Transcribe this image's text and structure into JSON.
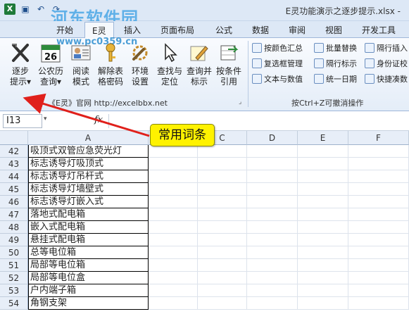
{
  "window": {
    "title": "E灵功能演示之逐步提示.xlsx - ",
    "watermark": "河东软件园",
    "watermark_url": "www.pc0359.cn"
  },
  "tabs": [
    "开始",
    "E灵",
    "插入",
    "页面布局",
    "公式",
    "数据",
    "审阅",
    "视图",
    "开发工具"
  ],
  "ribbon": {
    "big_buttons": [
      {
        "line1": "逐步",
        "line2": "提示▾",
        "icon": "cross-tools-icon"
      },
      {
        "line1": "公农历",
        "line2": "查询▾",
        "icon": "calendar-icon"
      },
      {
        "line1": "阅读",
        "line2": "模式",
        "icon": "people-card-icon"
      },
      {
        "line1": "解除表",
        "line2": "格密码",
        "icon": "key-icon"
      },
      {
        "line1": "环境",
        "line2": "设置",
        "icon": "wrench-settings-icon"
      },
      {
        "line1": "查找与",
        "line2": "定位",
        "icon": "cursor-icon"
      },
      {
        "line1": "查询并",
        "line2": "标示",
        "icon": "pen-mark-icon"
      },
      {
        "line1": "按条件",
        "line2": "引用",
        "icon": "reference-icon"
      }
    ],
    "calendar_number": "26",
    "left_group_label": "《E灵》官网  http://excelbbx.net",
    "small_buttons": [
      {
        "label": "按颜色汇总",
        "icon": "color-sum-icon"
      },
      {
        "label": "批量替换",
        "icon": "batch-replace-icon"
      },
      {
        "label": "隔行插入",
        "icon": "row-insert-icon"
      },
      {
        "label": "复选框管理",
        "icon": "checkbox-icon"
      },
      {
        "label": "隔行标示",
        "icon": "row-mark-icon"
      },
      {
        "label": "身份证校",
        "icon": "id-card-icon"
      },
      {
        "label": "文本与数值",
        "icon": "text-number-icon"
      },
      {
        "label": "统一日期",
        "icon": "date-icon"
      },
      {
        "label": "快捷凑数",
        "icon": "plus-icon"
      }
    ],
    "right_group_label": "按Ctrl+Z可撤消操作"
  },
  "formula_bar": {
    "name_box": "I13",
    "fx": "fx",
    "value": ""
  },
  "columns": [
    "A",
    "B",
    "C",
    "D",
    "E",
    "F"
  ],
  "rows": [
    {
      "num": "42",
      "a": "吸顶式双管应急荧光灯"
    },
    {
      "num": "43",
      "a": "标志诱导灯吸顶式"
    },
    {
      "num": "44",
      "a": "标志诱导灯吊杆式"
    },
    {
      "num": "45",
      "a": "标志诱导灯墙壁式"
    },
    {
      "num": "46",
      "a": "标志诱导灯嵌入式"
    },
    {
      "num": "47",
      "a": "落地式配电箱"
    },
    {
      "num": "48",
      "a": "嵌入式配电箱"
    },
    {
      "num": "49",
      "a": "悬挂式配电箱"
    },
    {
      "num": "50",
      "a": "总等电位箱"
    },
    {
      "num": "51",
      "a": "局部等电位箱"
    },
    {
      "num": "52",
      "a": "局部等电位盒"
    },
    {
      "num": "53",
      "a": "户内端子箱"
    },
    {
      "num": "54",
      "a": "角钢支架"
    }
  ],
  "callout": {
    "text": "常用词条",
    "color": "#fff200"
  },
  "colors": {
    "arrow": "#e0201b",
    "tab_bg": "#dde8f6"
  }
}
